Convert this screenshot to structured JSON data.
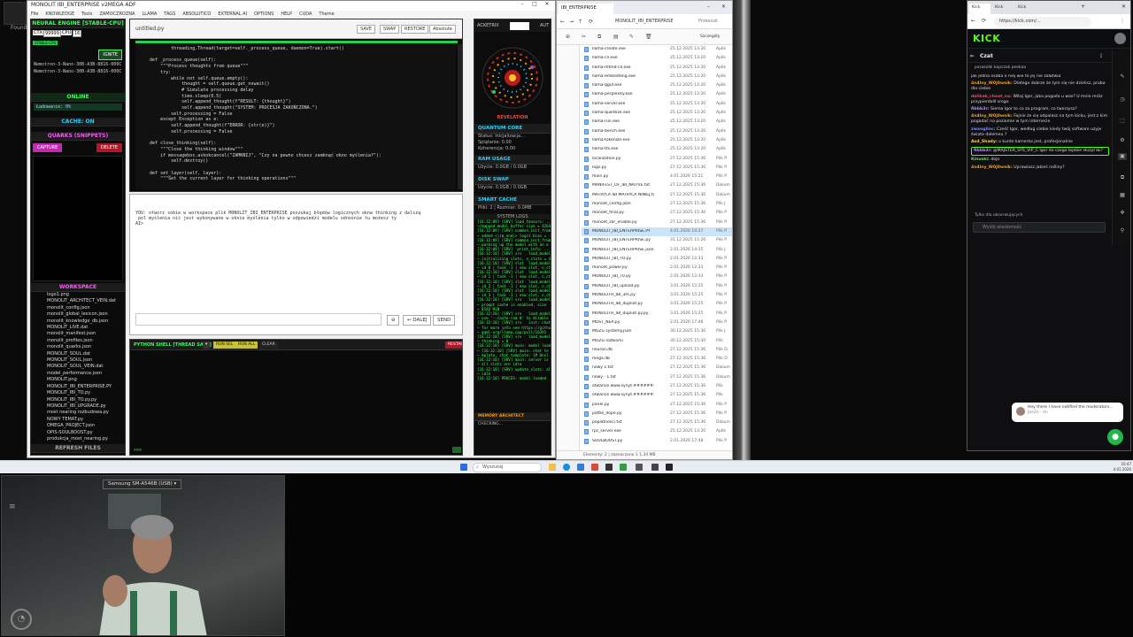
{
  "desktop": {
    "icon_label": "Found"
  },
  "app": {
    "title": "MONOLIT IBI_ENTERPRISE v2MEGA ADF",
    "menu": [
      "File",
      "KNOWLEDGE",
      "Tools",
      "ZAMOCZROZNA",
      "LLAMA",
      "TAGS",
      "ABSOLUTICO",
      "EXTERNAL AI",
      "OPTIONS",
      "HELP",
      "CUDA",
      "Theme"
    ],
    "left": {
      "engine_head": "NEURAL ENGINE [STABLE-CPU]",
      "ctx_label": "CTX:",
      "ctx_value": "99999",
      "cpu_label": "CPU",
      "cpu_value": "16",
      "stable_tag": "STABLE-CPU",
      "ignite": "IGNITE",
      "models": [
        "Nemotron-3-Nano-30B-A3B-8816-000C",
        "Nemotron-3-Nano-30B-A3B-8816-000C"
      ],
      "online": "ONLINE",
      "load": "Ładowanie: 0%",
      "cache": "CACHE: ON",
      "quarks_head": "QUARKS (SNIPPETS)",
      "capture": "CAPTURE",
      "delete": "DELETE",
      "workspace_head": "WORKSPACE",
      "files": [
        "logo1.png",
        "MONOLIT_ARCHITECT_VEIN.dat",
        "monolit_config.json",
        "monolit_global_lexicon.json",
        "monolit_knowledge_db.json",
        "MONOLIT_LIVE.dat",
        "monolit_manifest.json",
        "monolit_profiles.json",
        "monolit_quarks.json",
        "MONOLIT_SOUL.dat",
        "MONOLIT_SOUL.json",
        "MONOLIT_SOUL_VEIN.dat",
        "model_performance.json",
        "MONOLIT.png",
        "MONOLIT_IBI_ENTERPRISE.PY",
        "MONOLIT_IBI_TO.py",
        "MONOLIT_IBI_TO.py.py",
        "MONOLIT_IBI_UPGRADE.py",
        "most nearing rozbudowa.py",
        "NOWY TEMAT.py",
        "OMEGA_PROJECT.json",
        "OPIS-SOULBOOST.py",
        "produkcja_most_nearing.py"
      ],
      "refresh": "REFRESH FILES"
    },
    "editor": {
      "tab": "untitled.py",
      "buttons": [
        "SAVE",
        "SWAP",
        "RESTORE",
        "Absolute"
      ],
      "code": "            threading.Thread(target=self._process_queue, daemon=True).start()\n\n    def _process_queue(self):\n        \"\"\"Process thoughts from queue\"\"\"\n        try:\n            while not self.queue.empty():\n                thought = self.queue.get_nowait()\n                # Simulate processing delay\n                time.sleep(0.5)\n                self.append_thought(f\"RESULT: {thought}\")\n                self.append_thought(\"SYSTEM: PROCESJA ZAKOŃCZONA.\")\n            self.processing = False\n        except Exception as e:\n            self.append_thought(f\"ERROR: {str(e)}\")\n            self.processing = False\n\n    def close_thinking(self):\n        \"\"\"Close the thinking window\"\"\"\n        if messagebox.askokcancel(\"ZAMKNIJ\", \"Czy na pewno chcesz zamknąć okno myślenia?\"):\n            self.destroy()\n\n    def set_layer(self, layer):\n        \"\"\"Set the current layer for thinking operations\"\"\""
    },
    "thinking": {
      "text": "YOU: otworz sobie w workspace plik MONOLIT_IBI_ENTERPRISE poszukaj błędów logicznych okna thinking z dalszą\n pol myślenia nic jest wykonywane w oknie myślenia tylko w odpowiedzi modelu odnośnie tu możesz ty\nAI>",
      "continue": "DALEJ",
      "send": "SEND"
    },
    "shell": {
      "title": "PYTHON SHELL [THREAD SAFE]",
      "b1": "RUN SEL",
      "b2": "RUN ALL",
      "b3": "CLEAR",
      "restart": "RESTART",
      "prompt": ">>>"
    },
    "right": {
      "tab1": "ACKETRIX",
      "tab2": "AUT",
      "revelation": "REVELATION",
      "core_head": "QUANTUM CORE",
      "core_status": "Status: Inicjalizacja...",
      "core_split": "Splątanie: 0.00",
      "core_coh": "Koherencja: 0.00",
      "ram_head": "RAM USAGE",
      "ram_val": "Użycie: 0.0GB / 0.0GB",
      "disk_head": "DISK SWAP",
      "disk_val": "Użycie: 0.0GB / 0.0GB",
      "cache_head": "SMART CACHE",
      "cache_val": "Pliki: 2 | Rozmiar: 0.0MB",
      "logs_head": "SYSTEM LOGS",
      "logs": "[16:32:09] [SRV] load_tensors: ..\n~/mapped model buffer size = 4264\n[16:32:09] [SRV] common_init_from\n~ added <|im_end|> logit bias = -i\n[16:32:09] [SRV] common_init_from\n~ warming up the model with an e\n[16:32:09] [SRV]  print_info: ..\n[16:32:10] [SRV] srv   load_model\n~ initializing slots, n_slots = 4\n[16:32:10] [SRV] slot  load_model\n~ id 0 | task -1 | new slot, n_ctx\n[16:32:10] [SRV] slot  load_model\n~ id 1 | task -1 | new slot, n_ctx\n[16:32:10] [SRV] slot  load_model\n~ id 2 | task -1 | new slot, n_ctx\n[16:32:10] [SRV] slot  load_model\n~ id 3 | task -1 | new slot, n_ctx\n[16:32:10] [SRV] srv   load_model\n~ prompt cache is enabled, size\n~ 8192 MiB\n[16:32:10] [SRV] srv   load_model\n~ use '--cache-ram 0' to disable\n[16:32:10] [SRV] srv   init: chat\n~ for more info see https://github\n~ ggml-org/llama.cpp/pull/16391\n[16:32:10] [SRV] srv   load_model\n~ thinking = 0\n[16:32:10] [SRV] main: model load\n~ [16:32:10] [SRV] main: chat te\n~ mplate, chat_template: {# Unsl\n[16:32:10] [SRV] main: server is\n~ all slots are idle\n[16:32:10] [SRV] update_slots: al\n~ idle\n[16:32:10] PROCES: model loaded",
      "memory_head": "MEMORY ARCHITECT",
      "memory_val": "CHECKING..."
    }
  },
  "explorer": {
    "tab": "IBI_ENTERPRISE",
    "path": "MONOLIT_IBI_ENTERPRISE",
    "search": "Przeszuk",
    "sort": "Szczegóły",
    "columns": [
      "Nazwa",
      "Data modyfikacji",
      "Typ"
    ],
    "files": [
      [
        "Ilama-create.exe",
        "25.12.2025 13:20",
        "Aplik"
      ],
      [
        "Ilama-cli.exe",
        "25.12.2025 13:20",
        "Aplik"
      ],
      [
        "Ilama-mtmd-cli.exe",
        "25.12.2025 13:20",
        "Aplik"
      ],
      [
        "Ilama-embedding.exe",
        "25.12.2025 13:20",
        "Aplik"
      ],
      [
        "Ilama-gguf.exe",
        "25.12.2025 13:20",
        "Aplik"
      ],
      [
        "Ilama-perplexity.exe",
        "25.12.2025 13:20",
        "Aplik"
      ],
      [
        "Ilama-server.exe",
        "25.12.2025 13:20",
        "Aplik"
      ],
      [
        "Ilama-quantize.exe",
        "25.12.2025 13:20",
        "Aplik"
      ],
      [
        "Ilama-run.exe",
        "25.12.2025 13:20",
        "Aplik"
      ],
      [
        "Ilama-bench.exe",
        "25.12.2025 13:20",
        "Aplik"
      ],
      [
        "Ilama-tokenize.exe",
        "25.12.2025 13:20",
        "Aplik"
      ],
      [
        "Ilama-tts.exe",
        "25.12.2025 13:20",
        "Aplik"
      ],
      [
        "localization.py",
        "27.12.2025 15:36",
        "Plik P"
      ],
      [
        "logs.py",
        "27.12.2025 15:36",
        "Plik P"
      ],
      [
        "main.py",
        "4.01.2026 15:21",
        "Plik P"
      ],
      [
        "MANIFEST_OF_IBI_NATIVE.txt",
        "27.12.2025 15:36",
        "Dokum"
      ],
      [
        "MATRYCA IBI MATRYCA NINIEJ.txt",
        "27.12.2025 15:36",
        "Dokum"
      ],
      [
        "monolit_config.json",
        "27.12.2025 15:36",
        "Plik J"
      ],
      [
        "monolit_final.py",
        "27.12.2025 15:36",
        "Plik P"
      ],
      [
        "monolit_zar_enable.py",
        "27.12.2025 15:36",
        "Plik P"
      ],
      [
        "MONOLIT_IBI_ENTERPRISE.PY",
        "4.01.2026 16:27",
        "Plik P"
      ],
      [
        "MONOLIT_IBI_ENTERPRISE.py",
        "31.12.2025 15:26",
        "Plik P"
      ],
      [
        "MONOLIT_IBI_ENTERPRISE.json",
        "2.01.2026 14:35",
        "Plik J"
      ],
      [
        "MONOLIT_IBI_TO.py",
        "2.01.2026 12:33",
        "Plik P"
      ],
      [
        "monolit_power.py",
        "2.01.2026 12:33",
        "Plik P"
      ],
      [
        "MONOLIT_IBI_T0.py",
        "2.01.2026 12:33",
        "Plik P"
      ],
      [
        "MONOLIT_IBI_upload.py",
        "3.01.2026 15:25",
        "Plik P"
      ],
      [
        "MONOLITH_IBI_3m.py",
        "3.01.2026 15:25",
        "Plik P"
      ],
      [
        "MONOLITH_IBI_dupliot.py",
        "3.01.2026 15:25",
        "Plik P"
      ],
      [
        "MONOLITH_IBI_dupliot.py.py",
        "3.01.2026 15:25",
        "Plik P"
      ],
      [
        "MOST_NEA.py",
        "2.01.2026 17:48",
        "Plik P"
      ],
      [
        "MÓZG systemy.json",
        "30.12.2025 15:30",
        "Plik J"
      ],
      [
        "MÓZG rozbiorki",
        "30.12.2025 15:30",
        "Plik"
      ],
      [
        "neuron.db",
        "27.12.2025 15:36",
        "Plik D"
      ],
      [
        "mega.db",
        "27.12.2025 15:36",
        "Plik D"
      ],
      [
        "nowy 1.txt",
        "27.12.2025 15:36",
        "Dokum"
      ],
      [
        "nowy - 1.txt",
        "27.12.2025 15:36",
        "Dokum"
      ],
      [
        "otwarcie www.synyt.###########",
        "27.12.2025 15:36",
        "Plik"
      ],
      [
        "otwarcie www.synyt.###########",
        "27.12.2025 15:36",
        "Plik"
      ],
      [
        "panel.py",
        "27.12.2025 15:36",
        "Plik P"
      ],
      [
        "pattle_dope.py",
        "27.12.2025 15:36",
        "Plik P"
      ],
      [
        "poplatnosci.txt",
        "27.12.2025 15:36",
        "Dokum"
      ],
      [
        "rpc_server.exe",
        "25.12.2025 13:20",
        "Aplik"
      ],
      [
        "SOULBOOST.py",
        "2.01.2026 17:48",
        "Plik P"
      ]
    ],
    "selected_index": 20,
    "status": "Elementy: 2 | zaznaczono 1   1,34 MB"
  },
  "browser": {
    "tabs": [
      "Kick",
      "Kick",
      "Kick"
    ],
    "url": "https://kick.com/...",
    "brand": "KICK",
    "chat_title": "Czat",
    "pinned": "parasolki  kapczak  peekaa",
    "messages": [
      {
        "user": "",
        "text": "jak jedna osoba o niej wie to jej nie załatwia",
        "color": "#dddddd"
      },
      {
        "user": "4n4lny_W0j0wnik:",
        "text": "Dlatego dobrze że tym się nie dzielisz, proba dla ciebie",
        "color": "#f0a020"
      },
      {
        "user": "dalikak_cheat_na:",
        "text": "Witaj Igor, jaka pogoda u was? U mnie mróz przypierdolił srogo",
        "color": "#ff4060"
      },
      {
        "user": "fibbb3r:",
        "text": "Siema Igor to co za program, co tworzysz?",
        "color": "#bb88ff"
      },
      {
        "user": "4n4lny_W0j0wnik:",
        "text": "Fajnie że się odpalasz na tym kicku, jest z kim pogadać na poziomie w tym internecie",
        "color": "#f0a020"
      },
      {
        "user": "zwanglinc:",
        "text": "Cześć Igor, według ciebie kiedy twój software uzyje świata dalemeu ?",
        "color": "#8888ff"
      },
      {
        "user": "Asd_Shady:",
        "text": "o kurde kamerka jest, profesjonalnie",
        "color": "#ffd24a"
      },
      {
        "user": "fibbb3r:",
        "text": "@MAJSTER_SYS_VIP_C Igor do czego będzie służył ibi?",
        "color": "#bb88ff"
      },
      {
        "user": "Kinuski:",
        "text": "dojo",
        "color": "#6fd36f"
      },
      {
        "user": "4n4lny_W0j0wnik:",
        "text": "Uprawiasz jakieś rośliny?",
        "color": "#f0a020"
      }
    ],
    "followers_only": "Tylko dla obserwujących",
    "input_placeholder": "Wyślij wiadomość",
    "toast": "Hey there I have notified the moderators...",
    "toast_user": "JoeZe - dn"
  },
  "taskbar": {
    "search": "Wyszukaj",
    "time": "16:47",
    "date": "4.01.2026"
  },
  "webcam": {
    "label": "Samsung SM-A546B (USB)"
  }
}
